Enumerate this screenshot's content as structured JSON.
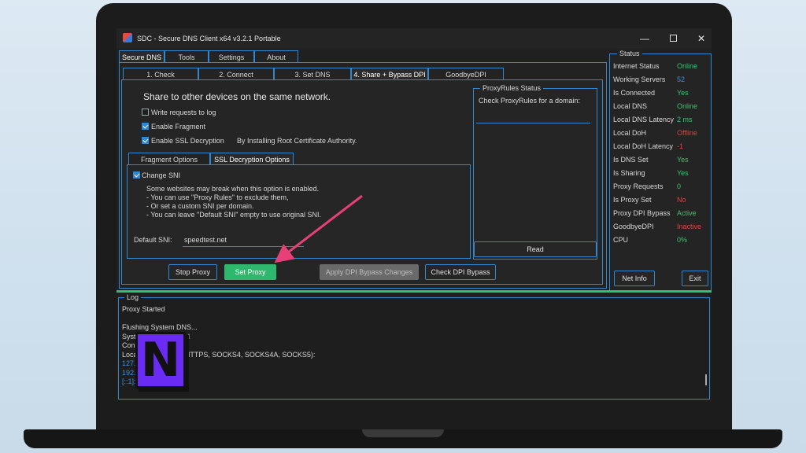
{
  "window": {
    "title": "SDC - Secure DNS Client x64 v3.2.1 Portable"
  },
  "main_tabs": [
    "Secure DNS",
    "Tools",
    "Settings",
    "About"
  ],
  "sub_tabs": [
    "1. Check",
    "2. Connect",
    "3. Set DNS",
    "4. Share + Bypass DPI",
    "GoodbyeDPI"
  ],
  "share": {
    "heading": "Share to other devices on the same network.",
    "write_requests": "Write requests to log",
    "enable_fragment": "Enable Fragment",
    "enable_ssl": "Enable SSL Decryption",
    "ssl_note": "By Installing Root Certificate Authority.",
    "inner_tabs": [
      "Fragment Options",
      "SSL Decryption Options"
    ],
    "change_sni": "Change SNI",
    "sni_help": [
      "Some websites may break when this option is enabled.",
      "- You can use \"Proxy Rules\" to exclude them,",
      "- Or set a custom SNI per domain.",
      "- You can leave \"Default SNI\" empty to use original SNI."
    ],
    "default_sni_label": "Default SNI:",
    "default_sni_value": "speedtest.net"
  },
  "proxy_rules": {
    "title": "ProxyRules Status",
    "label": "Check ProxyRules for a domain:",
    "read": "Read"
  },
  "buttons": {
    "stop_proxy": "Stop Proxy",
    "set_proxy": "Set Proxy",
    "apply_dpi": "Apply DPI Bypass Changes",
    "check_dpi": "Check DPI Bypass"
  },
  "status": {
    "title": "Status",
    "items": [
      {
        "label": "Internet Status",
        "value": "Online",
        "color": "#3ec06f"
      },
      {
        "label": "Working Servers",
        "value": "52",
        "color": "#3b8fe0"
      },
      {
        "label": "Is Connected",
        "value": "Yes",
        "color": "#3ec06f"
      },
      {
        "label": "Local DNS",
        "value": "Online",
        "color": "#3ec06f"
      },
      {
        "label": "Local DNS Latency",
        "value": "2 ms",
        "color": "#3ec06f"
      },
      {
        "label": "Local DoH",
        "value": "Offline",
        "color": "#e0443d"
      },
      {
        "label": "Local DoH Latency",
        "value": "-1",
        "color": "#e0443d"
      },
      {
        "label": "Is DNS Set",
        "value": "Yes",
        "color": "#3ec06f"
      },
      {
        "label": "Is Sharing",
        "value": "Yes",
        "color": "#3ec06f"
      },
      {
        "label": "Proxy Requests",
        "value": "0",
        "color": "#3ec06f"
      },
      {
        "label": "Is Proxy Set",
        "value": "No",
        "color": "#e0443d"
      },
      {
        "label": "Proxy DPI Bypass",
        "value": "Active",
        "color": "#3ec06f"
      },
      {
        "label": "GoodbyeDPI",
        "value": "Inactive",
        "color": "#e0443d"
      },
      {
        "label": "CPU",
        "value": "0%",
        "color": "#3ec06f"
      }
    ],
    "net_info": "Net Info",
    "exit": "Exit"
  },
  "log": {
    "title": "Log",
    "lines": [
      {
        "text": "Proxy Started",
        "color": "#d8d8d8"
      },
      {
        "text": "",
        "color": "#d8d8d8"
      },
      {
        "text": "Flushing System DNS...",
        "color": "#d8d8d8"
      },
      {
        "text": "System DNS Flushed",
        "color": "#d8d8d8"
      },
      {
        "text": "Con",
        "color": "#d8d8d8"
      },
      {
        "text": "Local Proxy (HTTP, HTTPS, SOCKS4, SOCKS4A, SOCKS5):",
        "color": "#d8d8d8"
      },
      {
        "text": "127.0.0.1:8080",
        "color": "#3b8fe0"
      },
      {
        "text": "192.168.1.2:8080",
        "color": "#3b8fe0"
      },
      {
        "text": "[::1]:8080",
        "color": "#3b8fe0"
      }
    ]
  },
  "overlay": {
    "logo_letter": "N"
  }
}
